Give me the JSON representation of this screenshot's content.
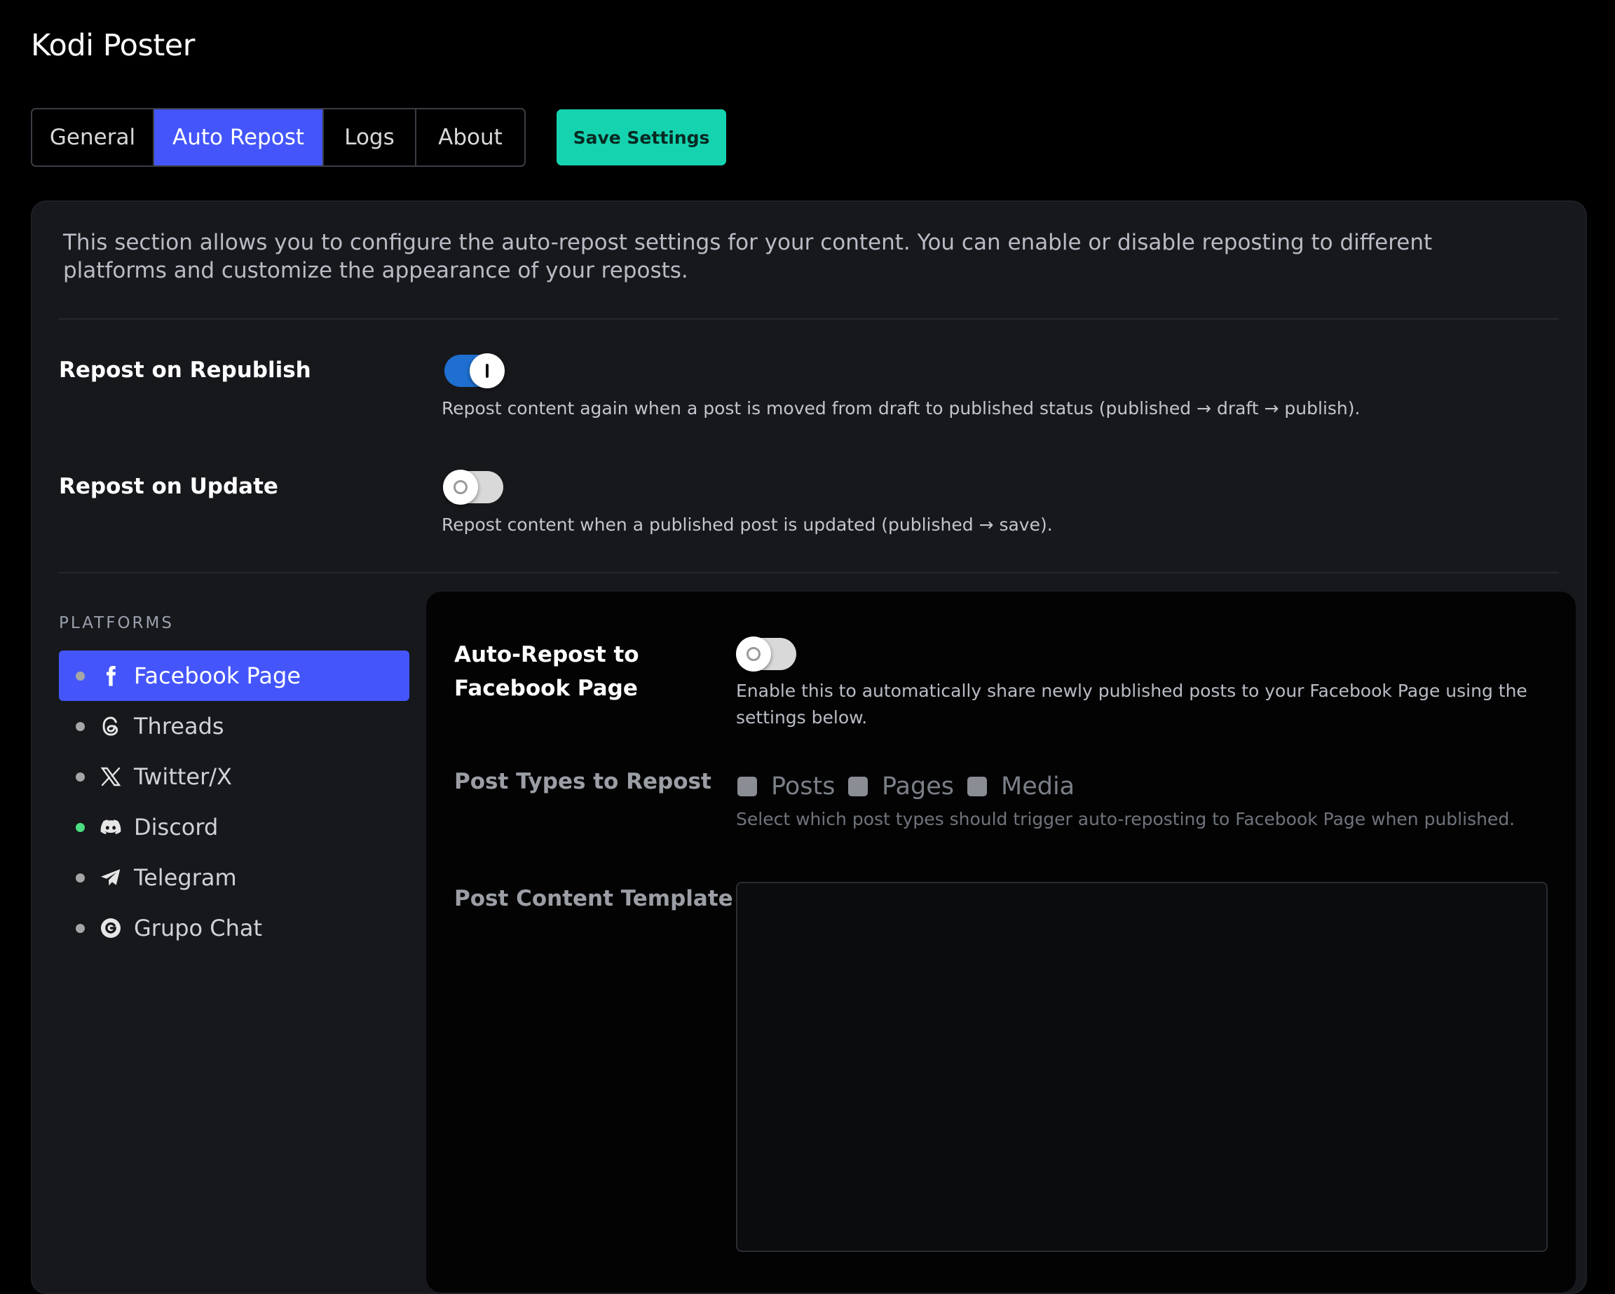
{
  "app": {
    "title": "Kodi Poster"
  },
  "tabs": [
    {
      "label": "General"
    },
    {
      "label": "Auto Repost"
    },
    {
      "label": "Logs"
    },
    {
      "label": "About"
    }
  ],
  "toolbar": {
    "save_label": "Save Settings"
  },
  "intro": "This section allows you to configure the auto-repost settings for your content. You can enable or disable reposting to different platforms and customize the appearance of your reposts.",
  "settings": {
    "republish": {
      "label": "Repost on Republish",
      "enabled": true,
      "help": "Repost content again when a post is moved from draft to published status (published → draft → publish)."
    },
    "update": {
      "label": "Repost on Update",
      "enabled": false,
      "help": "Repost content when a published post is updated (published → save)."
    }
  },
  "platforms": {
    "heading": "PLATFORMS",
    "items": [
      {
        "label": "Facebook Page",
        "icon": "facebook-icon",
        "active": true,
        "status_color": "#a6a6a6"
      },
      {
        "label": "Threads",
        "icon": "threads-icon",
        "active": false,
        "status_color": "#a6a6a6"
      },
      {
        "label": "Twitter/X",
        "icon": "x-icon",
        "active": false,
        "status_color": "#a6a6a6"
      },
      {
        "label": "Discord",
        "icon": "discord-icon",
        "active": false,
        "status_color": "#4ade80"
      },
      {
        "label": "Telegram",
        "icon": "telegram-icon",
        "active": false,
        "status_color": "#a6a6a6"
      },
      {
        "label": "Grupo Chat",
        "icon": "grupo-chat-icon",
        "active": false,
        "status_color": "#a6a6a6"
      }
    ]
  },
  "detail": {
    "auto_repost": {
      "label_line1": "Auto-Repost to",
      "label_line2": "Facebook Page",
      "enabled": false,
      "help": "Enable this to automatically share newly published posts to your Facebook Page using the settings below."
    },
    "post_types": {
      "label": "Post Types to Repost",
      "options": [
        {
          "label": "Posts",
          "checked": false
        },
        {
          "label": "Pages",
          "checked": false
        },
        {
          "label": "Media",
          "checked": false
        }
      ],
      "help": "Select which post types should trigger auto-reposting to Facebook Page when published."
    },
    "template": {
      "label": "Post Content Template",
      "value": ""
    }
  },
  "colors": {
    "accent": "#4456fb",
    "save_button": "#16d3b0",
    "toggle_on": "#1e6fd0",
    "background": "#000000",
    "panel": "#16181c"
  }
}
